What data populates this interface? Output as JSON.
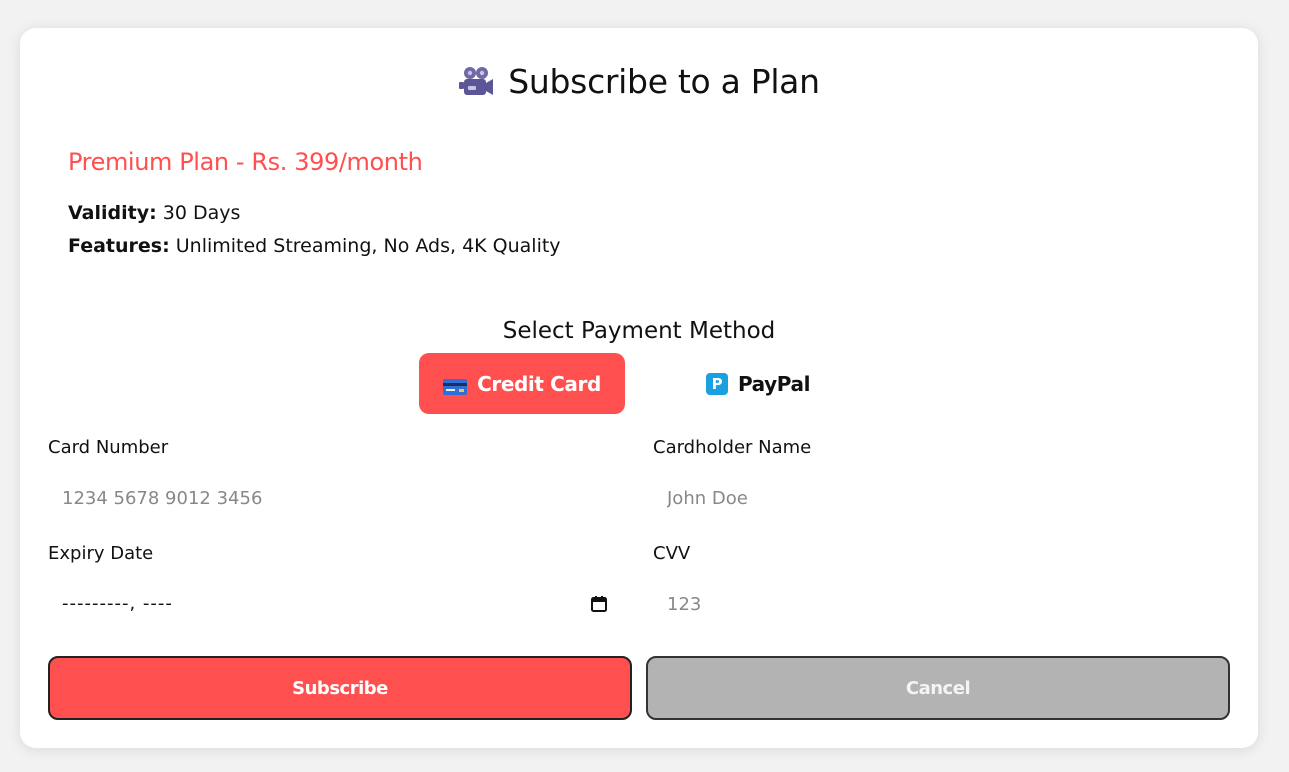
{
  "header": {
    "icon": "movie-camera-icon",
    "title": "Subscribe to a Plan"
  },
  "plan": {
    "name": "Premium Plan - Rs. 399/month",
    "validity_label": "Validity:",
    "validity_value": "30 Days",
    "features_label": "Features:",
    "features_value": "Unlimited Streaming, No Ads, 4K Quality"
  },
  "payment": {
    "title": "Select Payment Method",
    "methods": [
      {
        "label": "Credit Card",
        "icon": "credit-card-icon",
        "selected": true
      },
      {
        "label": "PayPal",
        "icon": "paypal-icon",
        "selected": false
      }
    ]
  },
  "form": {
    "card_number": {
      "label": "Card Number",
      "placeholder": "1234 5678 9012 3456"
    },
    "cardholder_name": {
      "label": "Cardholder Name",
      "placeholder": "John Doe"
    },
    "expiry_date": {
      "label": "Expiry Date",
      "value": "---------, ----"
    },
    "cvv": {
      "label": "CVV",
      "placeholder": "123"
    }
  },
  "actions": {
    "subscribe": "Subscribe",
    "cancel": "Cancel"
  },
  "colors": {
    "accent": "#ff4f4f",
    "cancel": "#b3b3b3",
    "paypal": "#1a9fe0"
  }
}
